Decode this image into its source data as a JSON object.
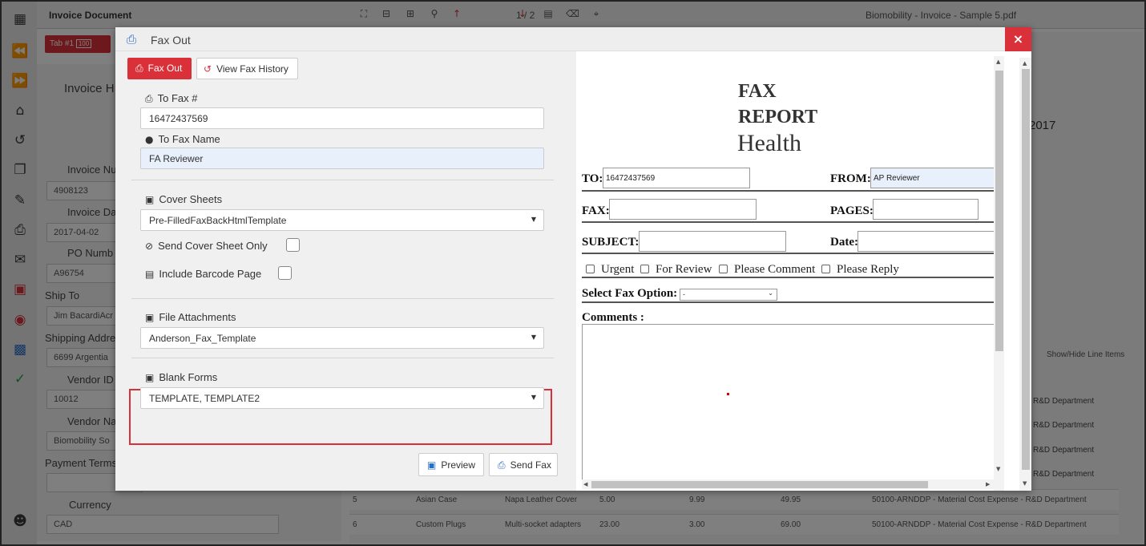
{
  "app": {
    "document_select": "Invoice Document",
    "pager": "1 / 2",
    "pdf_title": "Biomobility - Invoice - Sample 5.pdf",
    "tab": "Tab #1",
    "tab_badge": "100",
    "bg_year": "2017"
  },
  "bg_form": {
    "header": "Invoice H",
    "fields": [
      {
        "label": "Invoice Nu",
        "value": "4908123"
      },
      {
        "label": "Invoice Da",
        "value": "2017-04-02"
      },
      {
        "label": "PO Numb",
        "value": "A96754"
      },
      {
        "label": "Ship To",
        "value": "Jim BacardiAcr"
      },
      {
        "label": "Shipping Addre",
        "value": "6699 Argentia"
      },
      {
        "label": "Vendor ID",
        "value": "10012"
      },
      {
        "label": "Vendor Na",
        "value": "Biomobility So"
      },
      {
        "label": "Payment Terms",
        "value": ""
      },
      {
        "label": "Currency",
        "value": "CAD"
      }
    ]
  },
  "bg_table": {
    "show_hide": "Show/Hide Line Items",
    "dept_labels": [
      "R&D Department",
      "R&D Department",
      "R&D Department",
      "R&D Department"
    ],
    "rows": [
      {
        "num": "5",
        "item": "Asian Case",
        "desc": "Napa Leather Cover",
        "qty": "5.00",
        "price": "9.99",
        "total": "49.95",
        "account": "50100-ARNDDP - Material Cost Expense - R&D Department"
      },
      {
        "num": "6",
        "item": "Custom Plugs",
        "desc": "Multi-socket adapters",
        "qty": "23.00",
        "price": "3.00",
        "total": "69.00",
        "account": "50100-ARNDDP - Material Cost Expense - R&D Department"
      }
    ]
  },
  "modal": {
    "title": "Fax Out",
    "close": "×",
    "fax_out_button": "Fax Out",
    "history_button": "View Fax History",
    "to_fax_label": "To Fax #",
    "to_fax_value": "16472437569",
    "to_name_label": "To Fax Name",
    "to_name_value": "FA Reviewer",
    "cover_label": "Cover Sheets",
    "cover_value": "Pre-FilledFaxBackHtmlTemplate",
    "cover_only_label": "Send Cover Sheet Only",
    "barcode_label": "Include Barcode Page",
    "attach_label": "File Attachments",
    "attach_value": "Anderson_Fax_Template",
    "blank_label": "Blank Forms",
    "blank_value": "TEMPLATE, TEMPLATE2",
    "preview_button": "Preview",
    "send_button": "Send Fax"
  },
  "fax": {
    "title_line1": "FAX",
    "title_line2": "REPORT",
    "title_line3": "Health",
    "to_label": "TO:",
    "to_value": "16472437569",
    "from_label": "FROM:",
    "from_value": "AP Reviewer",
    "fax_label": "FAX:",
    "pages_label": "PAGES:",
    "subject_label": "SUBJECT:",
    "date_label": "Date:",
    "options": [
      "Urgent",
      "For Review",
      "Please Comment",
      "Please Reply"
    ],
    "select_label": "Select Fax Option:",
    "select_value": "-",
    "comments_label": "Comments :"
  },
  "colors": {
    "accent": "#d9303a",
    "link": "#2a6fc7"
  }
}
